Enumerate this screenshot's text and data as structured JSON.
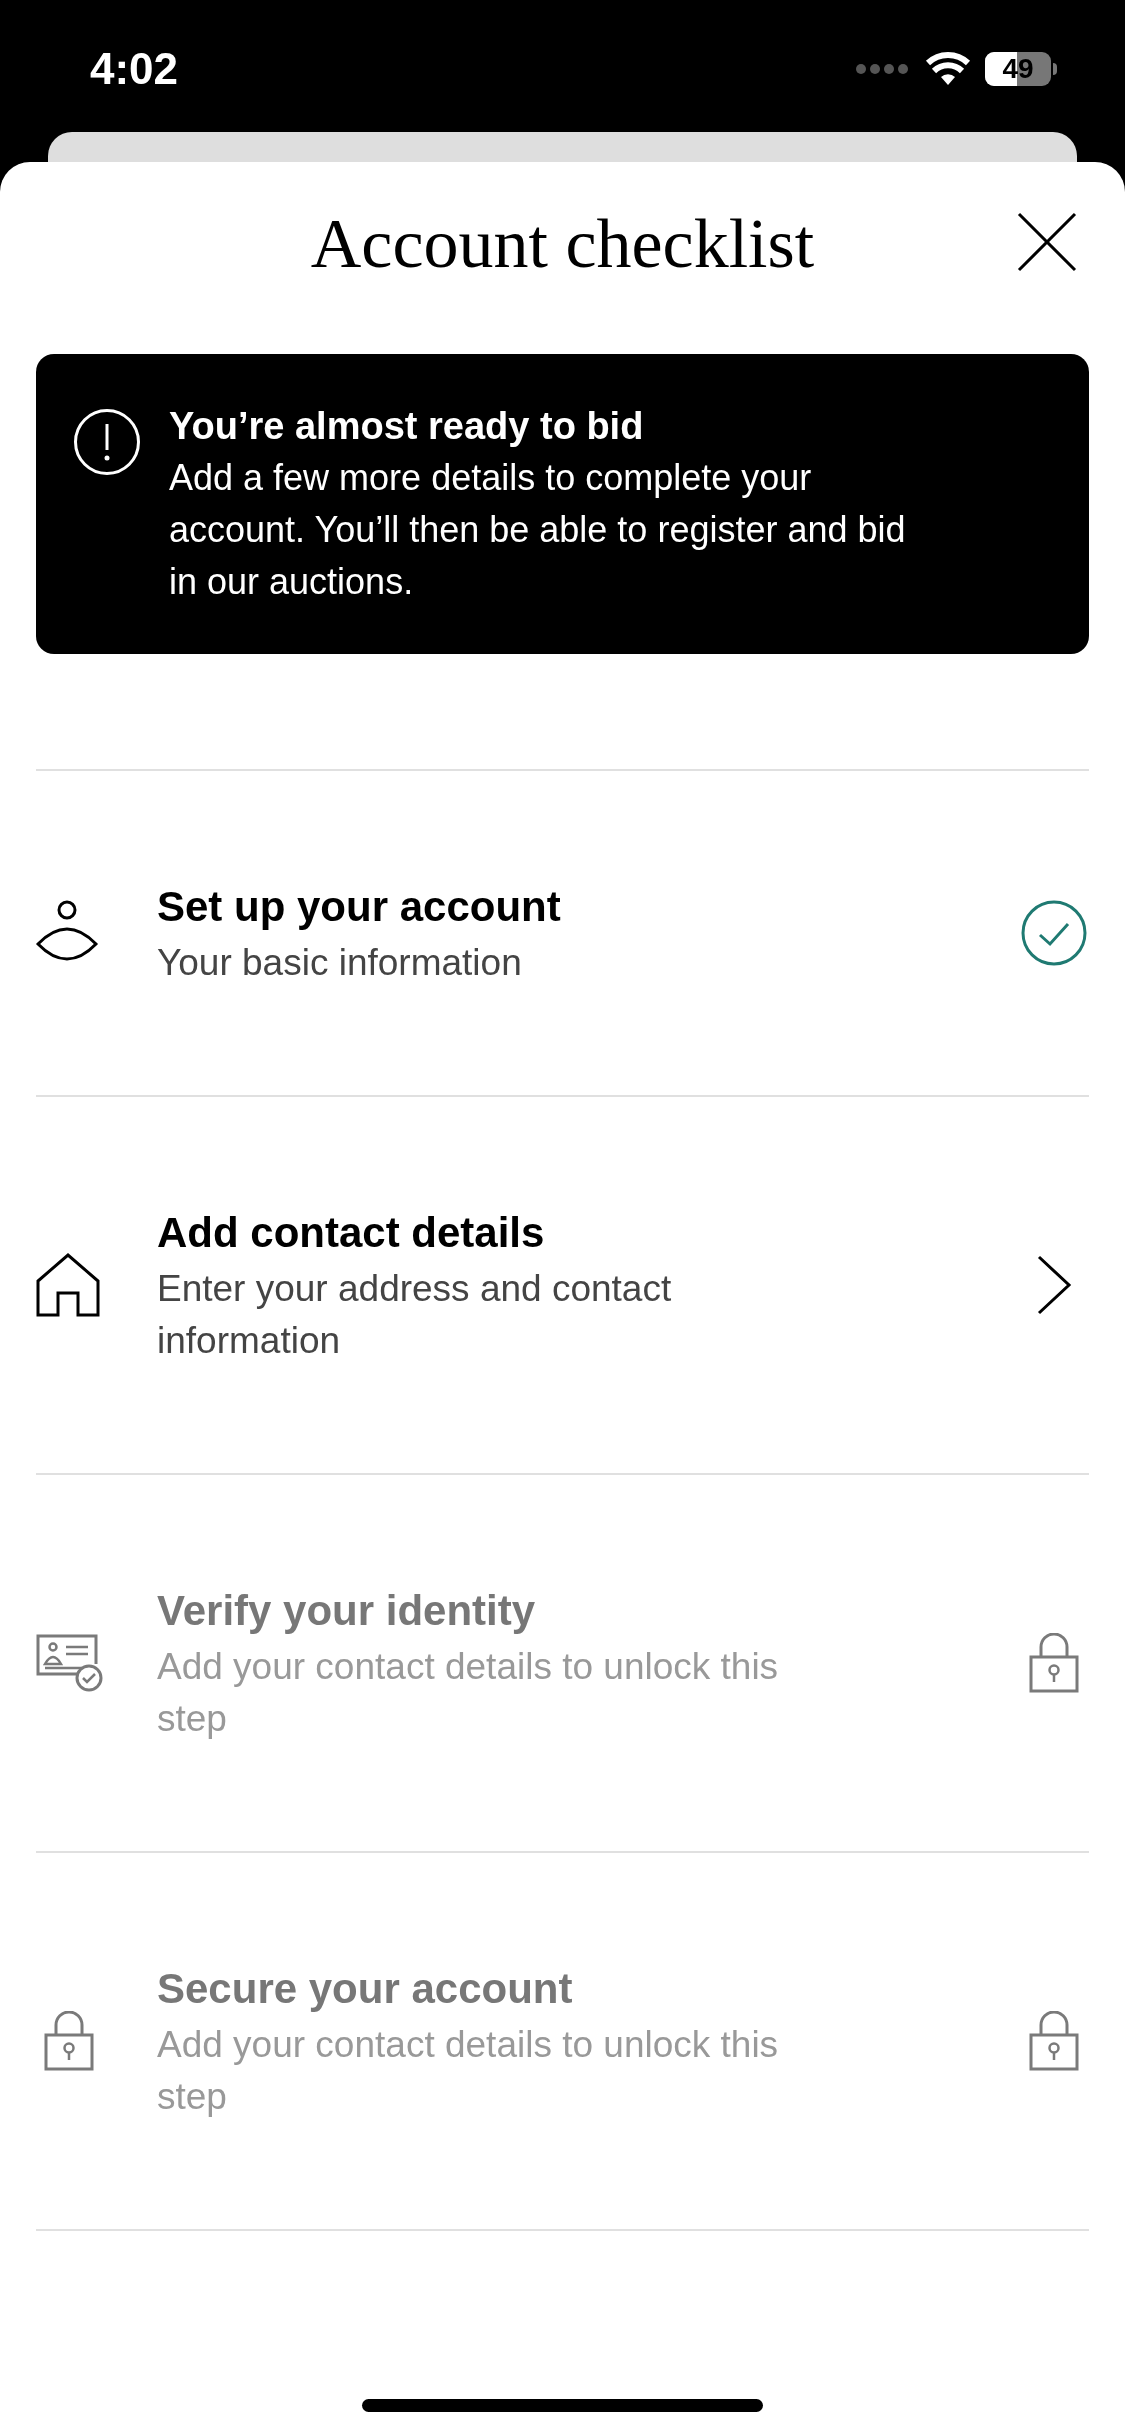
{
  "status_bar": {
    "time": "4:02",
    "battery": "49"
  },
  "sheet": {
    "title": "Account checklist"
  },
  "banner": {
    "title": "You’re almost ready to bid",
    "body": "Add a few more details to complete your account. You’ll then be able to register and bid in our auctions."
  },
  "steps": [
    {
      "kind": "person",
      "title": "Set up your account",
      "subtitle": "Your basic information",
      "complete": true,
      "locked": false
    },
    {
      "kind": "house",
      "title": "Add contact details",
      "subtitle": "Enter your address and contact information",
      "complete": false,
      "locked": false
    },
    {
      "kind": "identity",
      "title": "Verify your identity",
      "subtitle": "Add your contact details to unlock this step",
      "locked": true
    },
    {
      "kind": "security",
      "title": "Secure your account",
      "subtitle": "Add your contact details to unlock this step",
      "locked": true
    }
  ]
}
